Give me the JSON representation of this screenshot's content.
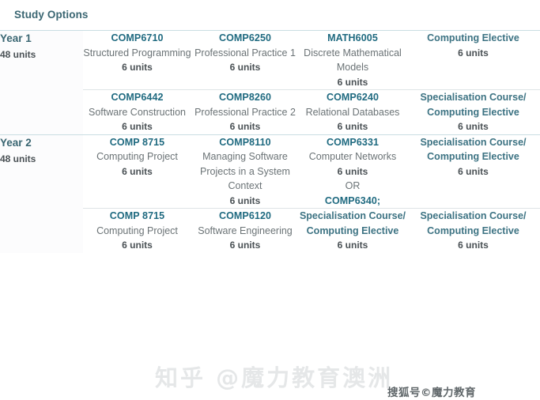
{
  "page": {
    "title": "Study Options"
  },
  "table": {
    "rows": [
      {
        "year": {
          "name": "Year 1",
          "units": "48 units"
        },
        "divider": "full",
        "cells": [
          {
            "code": "COMP6710",
            "title": "Structured Programming",
            "units": "6 units"
          },
          {
            "code": "COMP6250",
            "title": "Professional Practice 1",
            "units": "6 units"
          },
          {
            "code": "MATH6005",
            "title": "Discrete Mathematical Models",
            "units": "6 units"
          },
          {
            "elective": "Computing Elective",
            "units": "6 units"
          }
        ]
      },
      {
        "year": {
          "name": "",
          "units": ""
        },
        "divider": "inner",
        "cells": [
          {
            "code": "COMP6442",
            "title": "Software Construction",
            "units": "6 units"
          },
          {
            "code": "COMP8260",
            "title": "Professional Practice 2",
            "units": "6 units"
          },
          {
            "code": "COMP6240",
            "title": "Relational Databases",
            "units": "6 units"
          },
          {
            "elective": "Specialisation Course/ Computing Elective",
            "units": "6 units"
          }
        ]
      },
      {
        "year": {
          "name": "Year 2",
          "units": "48 units"
        },
        "divider": "full",
        "cells": [
          {
            "code": "COMP 8715",
            "title": "Computing Project",
            "units": "6 units"
          },
          {
            "code": "COMP8110",
            "title": "Managing Software Projects in a System Context",
            "units": "6 units"
          },
          {
            "code": "COMP6331",
            "title": "Computer Networks",
            "units": "6 units",
            "or": "OR",
            "alt_code": "COMP6340;"
          },
          {
            "elective": "Specialisation Course/ Computing Elective",
            "units": "6 units"
          }
        ]
      },
      {
        "year": {
          "name": "",
          "units": ""
        },
        "divider": "inner",
        "cells": [
          {
            "code": "COMP 8715",
            "title": "Computing Project",
            "units": "6 units"
          },
          {
            "code": "COMP6120",
            "title": "Software Engineering",
            "units": "6 units"
          },
          {
            "elective": "Specialisation Course/ Computing Elective",
            "units": "6 units"
          },
          {
            "elective": "Specialisation Course/ Computing Elective",
            "units": "6 units"
          }
        ]
      }
    ]
  },
  "watermark": {
    "primary": "知乎 @魔力教育澳洲",
    "secondary": "搜狐号©魔力教育"
  },
  "colors": {
    "heading": "#3a6672",
    "course_code": "#1f6a80",
    "elective": "#3d7383",
    "body_text": "#6b7376",
    "units": "#4a5155",
    "divider_major": "#c9dde2",
    "divider_minor": "#dfe4e6"
  }
}
